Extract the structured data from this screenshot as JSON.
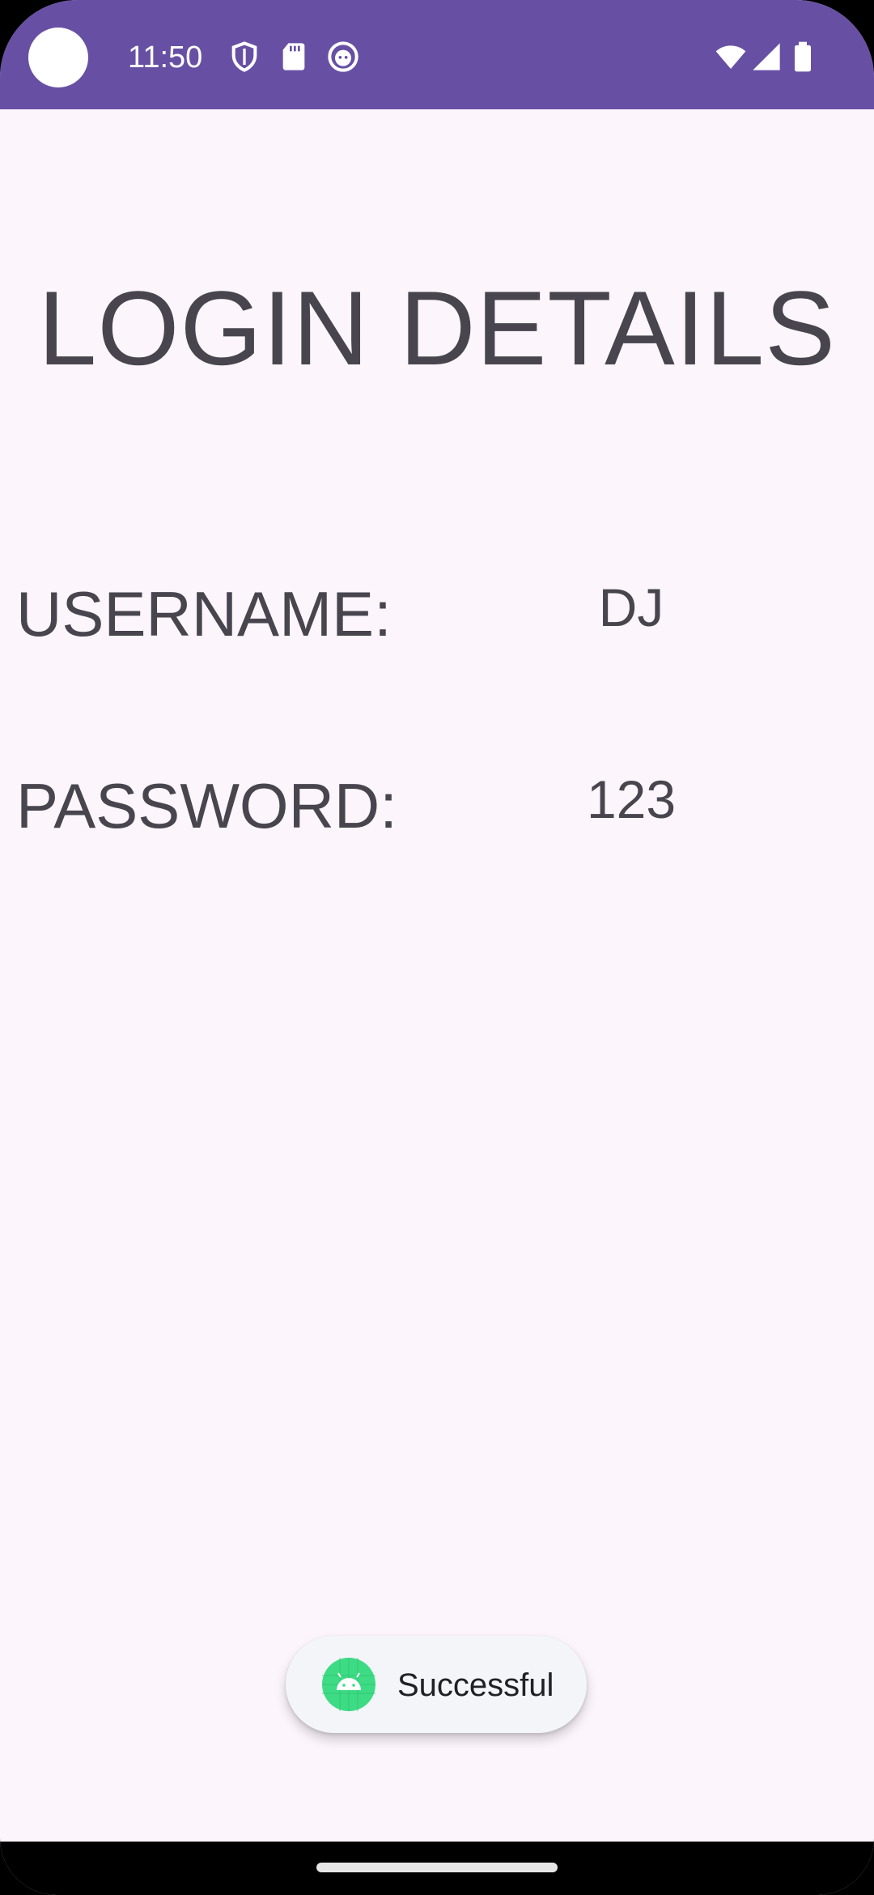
{
  "status_bar": {
    "time": "11:50",
    "left_icons": [
      "shield-icon",
      "sd-card-icon",
      "face-icon"
    ],
    "right_icons": [
      "wifi-icon",
      "cell-signal-icon",
      "battery-icon"
    ],
    "color": "#6750A4"
  },
  "page": {
    "title": "LOGIN DETAILS",
    "username_label": "USERNAME:",
    "username_value": "DJ",
    "password_label": "PASSWORD:",
    "password_value": "123"
  },
  "toast": {
    "icon": "android-icon",
    "message": "Successful"
  },
  "colors": {
    "background": "#FCF5FC",
    "text": "#48454E",
    "accent": "#6750A4"
  }
}
